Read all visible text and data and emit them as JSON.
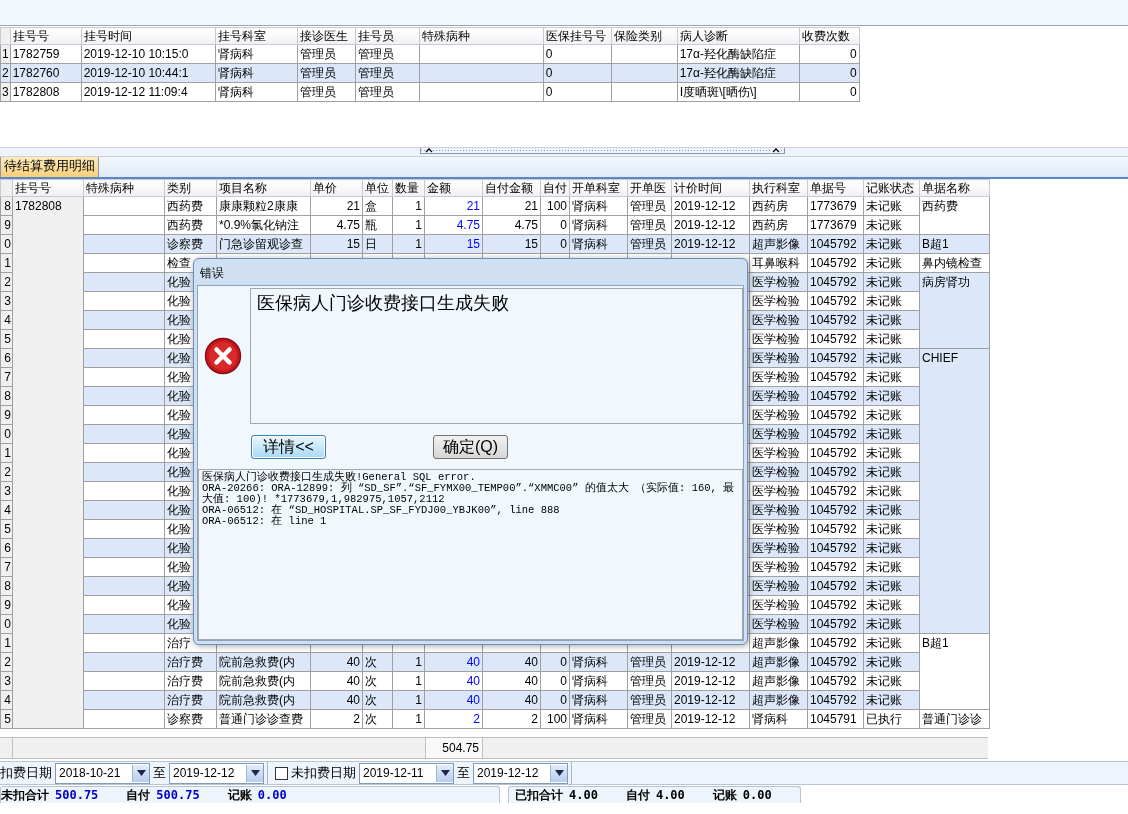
{
  "top_table": {
    "columns": [
      "挂号号",
      "挂号时间",
      "挂号科室",
      "接诊医生",
      "挂号员",
      "特殊病种",
      "医保挂号号",
      "保险类别",
      "病人诊断",
      "收费次数"
    ],
    "rows": [
      {
        "index": "1",
        "selected": false,
        "cells": [
          "1782759",
          "2019-12-10 10:15:0",
          "肾病科",
          "管理员",
          "管理员",
          null,
          "0",
          null,
          "17α-羟化酶缺陷症",
          "0"
        ]
      },
      {
        "index": "2",
        "selected": true,
        "cells": [
          "1782760",
          "2019-12-10 10:44:1",
          "肾病科",
          "管理员",
          "管理员",
          null,
          "0",
          null,
          "17α-羟化酶缺陷症",
          "0"
        ]
      },
      {
        "index": "3",
        "selected": false,
        "cells": [
          "1782808",
          "2019-12-12 11:09:4",
          "肾病科",
          "管理员",
          "管理员",
          null,
          "0",
          null,
          "Ⅰ度晒斑\\[晒伤\\]",
          "0"
        ]
      }
    ]
  },
  "tabs": [
    {
      "label": "待结算费用明细",
      "selected": true
    }
  ],
  "fee_table": {
    "columns": [
      "挂号号",
      "特殊病种",
      "类别",
      "项目名称",
      "单价",
      "单位",
      "数量",
      "金额",
      "自付金额",
      "自付",
      "开单科室",
      "开单医",
      "计价时间",
      "执行科室",
      "单据号",
      "记账状态",
      "单据名称"
    ],
    "rows": [
      {
        "index": "8",
        "cells": [
          "1782808",
          null,
          "西药费",
          "康康颗粒2康康",
          "21",
          "盒",
          "1",
          "21",
          "21",
          "100",
          "肾病科",
          "管理员",
          "2019-12-12",
          "西药房",
          "1773679",
          "未记账",
          "西药费"
        ]
      },
      {
        "index": "9",
        "cells": [
          null,
          null,
          "西药费",
          "*0.9%氯化钠注",
          "4.75",
          "瓶",
          "1",
          "4.75",
          "4.75",
          "0",
          "肾病科",
          "管理员",
          "2019-12-12",
          "西药房",
          "1773679",
          "未记账",
          null
        ]
      },
      {
        "index": "0",
        "cells": [
          null,
          null,
          "诊察费",
          "门急诊留观诊查",
          "15",
          "日",
          "1",
          "15",
          "15",
          "0",
          "肾病科",
          "管理员",
          "2019-12-12",
          "超声影像",
          "1045792",
          "未记账",
          "B超1"
        ]
      },
      {
        "index": "1",
        "cells": [
          null,
          null,
          "检查",
          null,
          null,
          null,
          null,
          null,
          null,
          null,
          null,
          null,
          null,
          "耳鼻喉科",
          "1045792",
          "未记账",
          "鼻内镜检查"
        ]
      },
      {
        "index": "2",
        "cells": [
          null,
          null,
          "化验",
          null,
          null,
          null,
          null,
          null,
          null,
          null,
          null,
          null,
          null,
          "医学检验",
          "1045792",
          "未记账",
          "病房肾功"
        ]
      },
      {
        "index": "3",
        "cells": [
          null,
          null,
          "化验",
          null,
          null,
          null,
          null,
          null,
          null,
          null,
          null,
          null,
          null,
          "医学检验",
          "1045792",
          "未记账",
          null
        ]
      },
      {
        "index": "4",
        "cells": [
          null,
          null,
          "化验",
          null,
          null,
          null,
          null,
          null,
          null,
          null,
          null,
          null,
          null,
          "医学检验",
          "1045792",
          "未记账",
          null
        ]
      },
      {
        "index": "5",
        "cells": [
          null,
          null,
          "化验",
          null,
          null,
          null,
          null,
          null,
          null,
          null,
          null,
          null,
          null,
          "医学检验",
          "1045792",
          "未记账",
          null
        ]
      },
      {
        "index": "6",
        "cells": [
          null,
          null,
          "化验",
          null,
          null,
          null,
          null,
          null,
          null,
          null,
          null,
          null,
          null,
          "医学检验",
          "1045792",
          "未记账",
          "CHIEF"
        ]
      },
      {
        "index": "7",
        "cells": [
          null,
          null,
          "化验",
          null,
          null,
          null,
          null,
          null,
          null,
          null,
          null,
          null,
          null,
          "医学检验",
          "1045792",
          "未记账",
          null
        ]
      },
      {
        "index": "8",
        "cells": [
          null,
          null,
          "化验",
          null,
          null,
          null,
          null,
          null,
          null,
          null,
          null,
          null,
          null,
          "医学检验",
          "1045792",
          "未记账",
          null
        ]
      },
      {
        "index": "9",
        "cells": [
          null,
          null,
          "化验",
          null,
          null,
          null,
          null,
          null,
          null,
          null,
          null,
          null,
          null,
          "医学检验",
          "1045792",
          "未记账",
          null
        ]
      },
      {
        "index": "0",
        "cells": [
          null,
          null,
          "化验",
          null,
          null,
          null,
          null,
          null,
          null,
          null,
          null,
          null,
          null,
          "医学检验",
          "1045792",
          "未记账",
          null
        ]
      },
      {
        "index": "1",
        "cells": [
          null,
          null,
          "化验",
          null,
          null,
          null,
          null,
          null,
          null,
          null,
          null,
          null,
          null,
          "医学检验",
          "1045792",
          "未记账",
          null
        ]
      },
      {
        "index": "2",
        "cells": [
          null,
          null,
          "化验",
          null,
          null,
          null,
          null,
          null,
          null,
          null,
          null,
          null,
          null,
          "医学检验",
          "1045792",
          "未记账",
          null
        ]
      },
      {
        "index": "3",
        "cells": [
          null,
          null,
          "化验",
          null,
          null,
          null,
          null,
          null,
          null,
          null,
          null,
          null,
          null,
          "医学检验",
          "1045792",
          "未记账",
          null
        ]
      },
      {
        "index": "4",
        "cells": [
          null,
          null,
          "化验",
          null,
          null,
          null,
          null,
          null,
          null,
          null,
          null,
          null,
          null,
          "医学检验",
          "1045792",
          "未记账",
          null
        ]
      },
      {
        "index": "5",
        "cells": [
          null,
          null,
          "化验",
          null,
          null,
          null,
          null,
          null,
          null,
          null,
          null,
          null,
          null,
          "医学检验",
          "1045792",
          "未记账",
          null
        ]
      },
      {
        "index": "6",
        "cells": [
          null,
          null,
          "化验",
          null,
          null,
          null,
          null,
          null,
          null,
          null,
          null,
          null,
          null,
          "医学检验",
          "1045792",
          "未记账",
          null
        ]
      },
      {
        "index": "7",
        "cells": [
          null,
          null,
          "化验",
          null,
          null,
          null,
          null,
          null,
          null,
          null,
          null,
          null,
          null,
          "医学检验",
          "1045792",
          "未记账",
          null
        ]
      },
      {
        "index": "8",
        "cells": [
          null,
          null,
          "化验",
          null,
          null,
          null,
          null,
          null,
          null,
          null,
          null,
          null,
          null,
          "医学检验",
          "1045792",
          "未记账",
          null
        ]
      },
      {
        "index": "9",
        "cells": [
          null,
          null,
          "化验",
          null,
          null,
          null,
          null,
          null,
          null,
          null,
          null,
          null,
          null,
          "医学检验",
          "1045792",
          "未记账",
          null
        ]
      },
      {
        "index": "0",
        "cells": [
          null,
          null,
          "化验",
          null,
          null,
          null,
          null,
          null,
          null,
          null,
          null,
          null,
          null,
          "医学检验",
          "1045792",
          "未记账",
          null
        ]
      },
      {
        "index": "1",
        "cells": [
          null,
          null,
          "治疗",
          null,
          null,
          null,
          null,
          null,
          null,
          null,
          null,
          null,
          null,
          "超声影像",
          "1045792",
          "未记账",
          "B超1"
        ]
      },
      {
        "index": "2",
        "cells": [
          null,
          null,
          "治疗费",
          "院前急救费(内",
          "40",
          "次",
          "1",
          "40",
          "40",
          "0",
          "肾病科",
          "管理员",
          "2019-12-12",
          "超声影像",
          "1045792",
          "未记账",
          null
        ]
      },
      {
        "index": "3",
        "cells": [
          null,
          null,
          "治疗费",
          "院前急救费(内",
          "40",
          "次",
          "1",
          "40",
          "40",
          "0",
          "肾病科",
          "管理员",
          "2019-12-12",
          "超声影像",
          "1045792",
          "未记账",
          null
        ]
      },
      {
        "index": "4",
        "cells": [
          null,
          null,
          "治疗费",
          "院前急救费(内",
          "40",
          "次",
          "1",
          "40",
          "40",
          "0",
          "肾病科",
          "管理员",
          "2019-12-12",
          "超声影像",
          "1045792",
          "未记账",
          null
        ]
      },
      {
        "index": "5",
        "cells": [
          null,
          null,
          "诊察费",
          "普通门诊诊查费",
          "2",
          "次",
          "1",
          "2",
          "2",
          "100",
          "肾病科",
          "管理员",
          "2019-12-12",
          "肾病科",
          "1045791",
          "已执行",
          "普通门诊诊"
        ]
      }
    ],
    "total": "504.75"
  },
  "filters": [
    {
      "kind": "plain",
      "label": "扣费日期",
      "from": "2018-10-21",
      "separator": "至",
      "to": "2019-12-12"
    },
    {
      "kind": "checkbox",
      "checked": false,
      "label": "未扣费日期",
      "from": "2019-12-11",
      "separator": "至",
      "to": "2019-12-12"
    }
  ],
  "summaries": [
    {
      "kind": "pending",
      "items": [
        {
          "label": "未扣合计",
          "value": "500.75"
        },
        {
          "label": "自付",
          "value": "500.75"
        },
        {
          "label": "记账",
          "value": "0.00"
        }
      ]
    },
    {
      "kind": "settled",
      "items": [
        {
          "label": "已扣合计",
          "value": "4.00"
        },
        {
          "label": "自付",
          "value": "4.00"
        },
        {
          "label": "记账",
          "value": "0.00"
        }
      ]
    }
  ],
  "dialog": {
    "title": "错误",
    "message": "医保病人门诊收费接口生成失败",
    "buttons": [
      {
        "label": "详情<<",
        "focused": true
      },
      {
        "label": "确定(Q)",
        "focused": false
      }
    ],
    "details": "医保病人门诊收费接口生成失败!General SQL error.\nORA-20266: ORA-12899: 列 “SD_SF”.“SF_FYMX00_TEMP00”.“XMMC00” 的值太大 （实际值: 160, 最大值: 100)! *1773679,1,982975,1057,2112\nORA-06512: 在 “SD_HOSPITAL.SP_SF_FYDJ00_YBJK00”, line 888\nORA-06512: 在 line 1"
  }
}
